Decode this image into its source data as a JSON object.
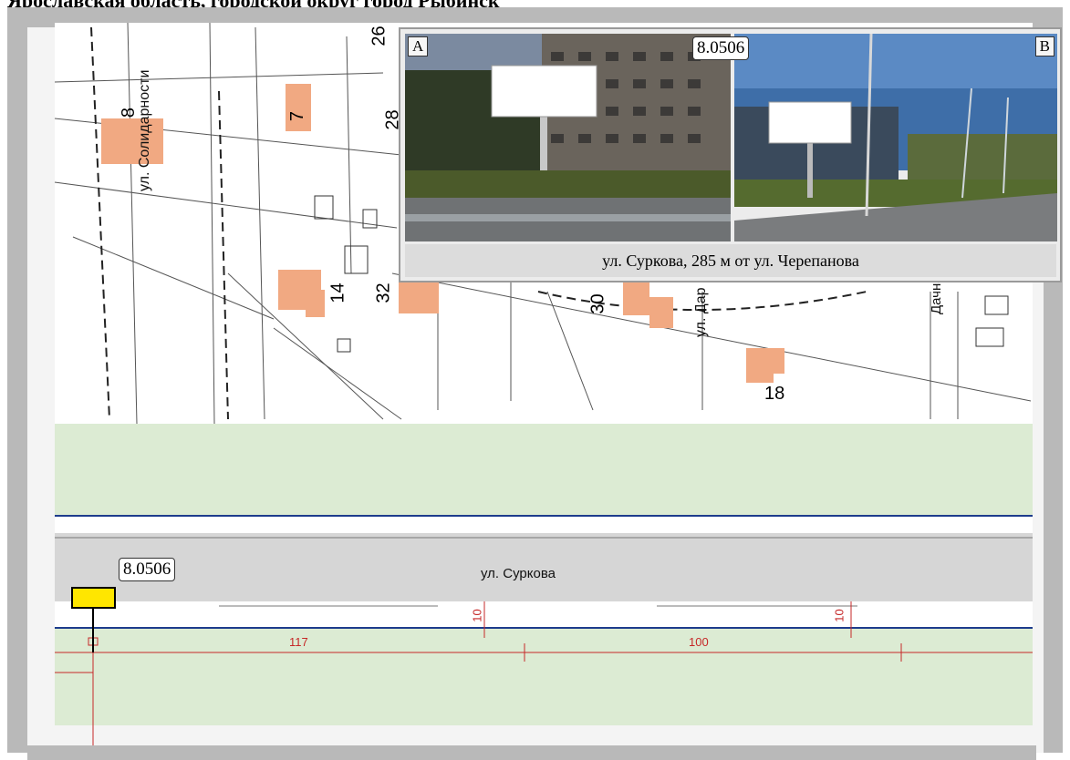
{
  "header": {
    "title": "Ярославская область, городской округ город Рыбинск"
  },
  "inset": {
    "label_a": "A",
    "label_b": "B",
    "id": "8.0506",
    "caption": "ул. Суркова, 285 м от ул. Черепанова"
  },
  "map": {
    "marker_id": "8.0506",
    "streets": {
      "solidarnosti": "ул. Солидарности",
      "surkova": "ул. Суркова",
      "partial_right": "ул. Дар",
      "partial_far": "Дачна"
    },
    "building_numbers": [
      "8",
      "7",
      "26",
      "28",
      "14",
      "32",
      "30",
      "18"
    ],
    "dimensions": {
      "d1": "117",
      "d2": "100",
      "h1": "10",
      "h2": "10"
    }
  },
  "colors": {
    "building": "#f1a982",
    "green_zone": "#dcebd3",
    "road": "#d6d6d6",
    "road_edge": "#1d3c8c",
    "marker": "#ffe600",
    "dimension": "#c62828"
  }
}
